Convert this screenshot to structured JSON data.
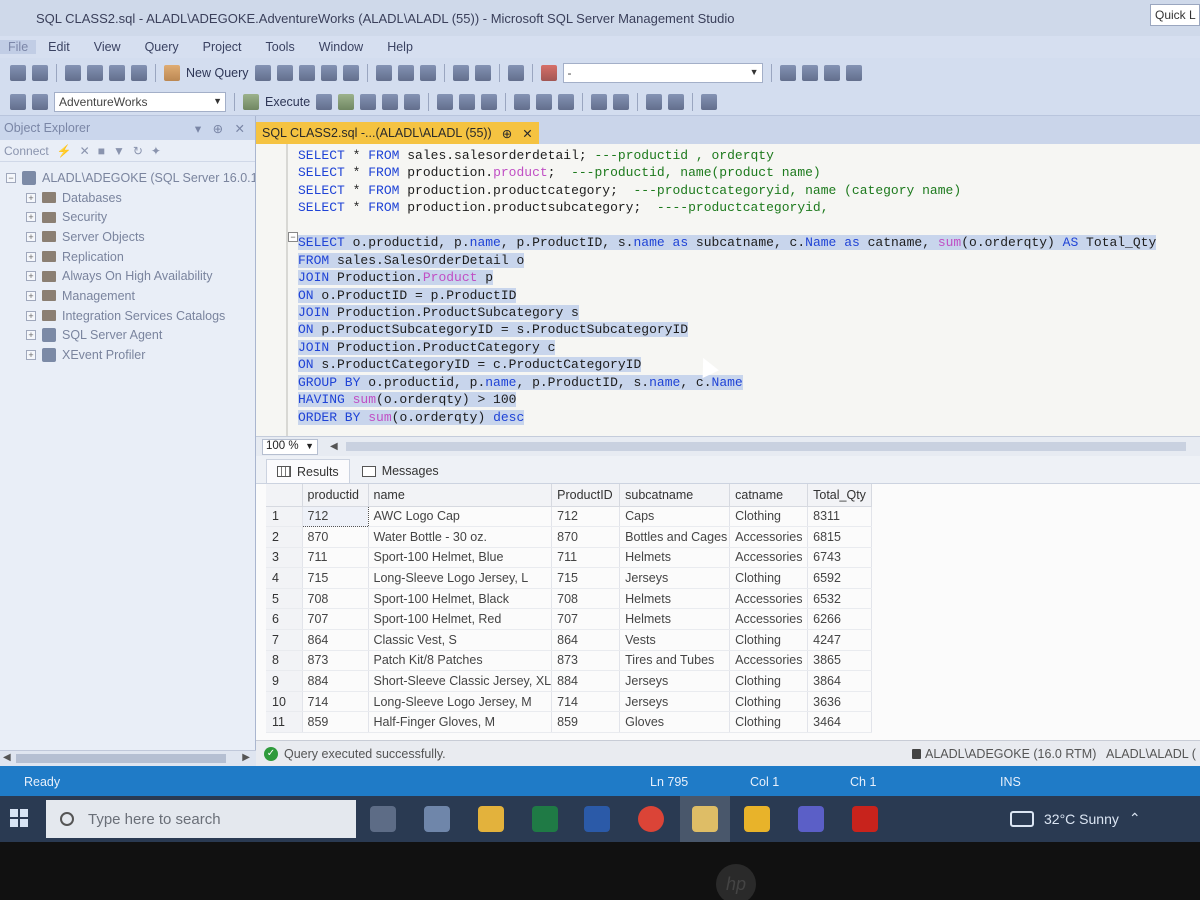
{
  "window": {
    "title": "SQL CLASS2.sql - ALADL\\ADEGOKE.AdventureWorks (ALADL\\ALADL (55)) - Microsoft SQL Server Management Studio",
    "quick_launch": "Quick L"
  },
  "menu": [
    "File",
    "Edit",
    "View",
    "Query",
    "Project",
    "Tools",
    "Window",
    "Help"
  ],
  "toolbar": {
    "new_query": "New Query",
    "execute": "Execute",
    "database": "AdventureWorks",
    "solution_combo": "-"
  },
  "object_explorer": {
    "title": "Object Explorer",
    "connect": "Connect",
    "server": "ALADL\\ADEGOKE (SQL Server 16.0.1",
    "nodes": [
      "Databases",
      "Security",
      "Server Objects",
      "Replication",
      "Always On High Availability",
      "Management",
      "Integration Services Catalogs",
      "SQL Server Agent",
      "XEvent Profiler"
    ]
  },
  "document_tab": {
    "label": "SQL CLASS2.sql -...(ALADL\\ALADL (55))",
    "pin": "⊕",
    "close": "✕"
  },
  "editor": {
    "lines": [
      {
        "selected": false,
        "tokens": [
          {
            "t": "kw",
            "v": "SELECT"
          },
          {
            "t": "txt",
            "v": " * "
          },
          {
            "t": "kw",
            "v": "FROM"
          },
          {
            "t": "txt",
            "v": " sales.salesorderdetail; "
          },
          {
            "t": "cm",
            "v": "---productid , orderqty"
          }
        ]
      },
      {
        "selected": false,
        "tokens": [
          {
            "t": "kw",
            "v": "SELECT"
          },
          {
            "t": "txt",
            "v": " * "
          },
          {
            "t": "kw",
            "v": "FROM"
          },
          {
            "t": "txt",
            "v": " production."
          },
          {
            "t": "fn",
            "v": "product"
          },
          {
            "t": "txt",
            "v": ";  "
          },
          {
            "t": "cm",
            "v": "---productid, name(product name)"
          }
        ]
      },
      {
        "selected": false,
        "tokens": [
          {
            "t": "kw",
            "v": "SELECT"
          },
          {
            "t": "txt",
            "v": " * "
          },
          {
            "t": "kw",
            "v": "FROM"
          },
          {
            "t": "txt",
            "v": " production.productcategory;  "
          },
          {
            "t": "cm",
            "v": "---productcategoryid, name (category name)"
          }
        ]
      },
      {
        "selected": false,
        "tokens": [
          {
            "t": "kw",
            "v": "SELECT"
          },
          {
            "t": "txt",
            "v": " * "
          },
          {
            "t": "kw",
            "v": "FROM"
          },
          {
            "t": "txt",
            "v": " production.productsubcategory;  "
          },
          {
            "t": "cm",
            "v": "----productcategoryid,"
          }
        ]
      },
      {
        "selected": false,
        "tokens": [
          {
            "t": "txt",
            "v": " "
          }
        ]
      },
      {
        "selected": true,
        "tokens": [
          {
            "t": "kw",
            "v": "SELECT"
          },
          {
            "t": "txt",
            "v": " o.productid, p."
          },
          {
            "t": "kw",
            "v": "name"
          },
          {
            "t": "txt",
            "v": ", p.ProductID, s."
          },
          {
            "t": "kw",
            "v": "name"
          },
          {
            "t": "txt",
            "v": " "
          },
          {
            "t": "kw",
            "v": "as"
          },
          {
            "t": "txt",
            "v": " subcatname, c."
          },
          {
            "t": "kw",
            "v": "Name"
          },
          {
            "t": "txt",
            "v": " "
          },
          {
            "t": "kw",
            "v": "as"
          },
          {
            "t": "txt",
            "v": " catname, "
          },
          {
            "t": "fn",
            "v": "sum"
          },
          {
            "t": "txt",
            "v": "(o.orderqty) "
          },
          {
            "t": "kw",
            "v": "AS"
          },
          {
            "t": "txt",
            "v": " Total_Qty"
          }
        ]
      },
      {
        "selected": true,
        "tokens": [
          {
            "t": "kw",
            "v": "FROM"
          },
          {
            "t": "txt",
            "v": " sales.SalesOrderDetail o"
          }
        ]
      },
      {
        "selected": true,
        "tokens": [
          {
            "t": "kw",
            "v": "JOIN"
          },
          {
            "t": "txt",
            "v": " Production."
          },
          {
            "t": "fn",
            "v": "Product"
          },
          {
            "t": "txt",
            "v": " p"
          }
        ]
      },
      {
        "selected": true,
        "tokens": [
          {
            "t": "kw",
            "v": "ON"
          },
          {
            "t": "txt",
            "v": " o.ProductID = p.ProductID"
          }
        ]
      },
      {
        "selected": true,
        "tokens": [
          {
            "t": "kw",
            "v": "JOIN"
          },
          {
            "t": "txt",
            "v": " Production.ProductSubcategory s"
          }
        ]
      },
      {
        "selected": true,
        "tokens": [
          {
            "t": "kw",
            "v": "ON"
          },
          {
            "t": "txt",
            "v": " p.ProductSubcategoryID = s.ProductSubcategoryID"
          }
        ]
      },
      {
        "selected": true,
        "tokens": [
          {
            "t": "kw",
            "v": "JOIN"
          },
          {
            "t": "txt",
            "v": " Production.ProductCategory c"
          }
        ]
      },
      {
        "selected": true,
        "tokens": [
          {
            "t": "kw",
            "v": "ON"
          },
          {
            "t": "txt",
            "v": " s.ProductCategoryID = c.ProductCategoryID"
          }
        ]
      },
      {
        "selected": true,
        "tokens": [
          {
            "t": "kw",
            "v": "GROUP BY"
          },
          {
            "t": "txt",
            "v": " o.productid, p."
          },
          {
            "t": "kw",
            "v": "name"
          },
          {
            "t": "txt",
            "v": ", p.ProductID, s."
          },
          {
            "t": "kw",
            "v": "name"
          },
          {
            "t": "txt",
            "v": ", c."
          },
          {
            "t": "kw",
            "v": "Name"
          }
        ]
      },
      {
        "selected": true,
        "tokens": [
          {
            "t": "kw",
            "v": "HAVING"
          },
          {
            "t": "txt",
            "v": " "
          },
          {
            "t": "fn",
            "v": "sum"
          },
          {
            "t": "txt",
            "v": "(o.orderqty) > 100"
          }
        ]
      },
      {
        "selected": true,
        "tokens": [
          {
            "t": "kw",
            "v": "ORDER BY"
          },
          {
            "t": "txt",
            "v": " "
          },
          {
            "t": "fn",
            "v": "sum"
          },
          {
            "t": "txt",
            "v": "(o.orderqty) "
          },
          {
            "t": "kw",
            "v": "desc"
          }
        ]
      }
    ]
  },
  "zoom": "100 %",
  "results_tabs": {
    "results": "Results",
    "messages": "Messages"
  },
  "results": {
    "columns": [
      "productid",
      "name",
      "ProductID",
      "subcatname",
      "catname",
      "Total_Qty"
    ],
    "rows": [
      [
        "1",
        "712",
        "AWC Logo Cap",
        "712",
        "Caps",
        "Clothing",
        "8311"
      ],
      [
        "2",
        "870",
        "Water Bottle - 30 oz.",
        "870",
        "Bottles and Cages",
        "Accessories",
        "6815"
      ],
      [
        "3",
        "711",
        "Sport-100 Helmet, Blue",
        "711",
        "Helmets",
        "Accessories",
        "6743"
      ],
      [
        "4",
        "715",
        "Long-Sleeve Logo Jersey, L",
        "715",
        "Jerseys",
        "Clothing",
        "6592"
      ],
      [
        "5",
        "708",
        "Sport-100 Helmet, Black",
        "708",
        "Helmets",
        "Accessories",
        "6532"
      ],
      [
        "6",
        "707",
        "Sport-100 Helmet, Red",
        "707",
        "Helmets",
        "Accessories",
        "6266"
      ],
      [
        "7",
        "864",
        "Classic Vest, S",
        "864",
        "Vests",
        "Clothing",
        "4247"
      ],
      [
        "8",
        "873",
        "Patch Kit/8 Patches",
        "873",
        "Tires and Tubes",
        "Accessories",
        "3865"
      ],
      [
        "9",
        "884",
        "Short-Sleeve Classic Jersey, XL",
        "884",
        "Jerseys",
        "Clothing",
        "3864"
      ],
      [
        "10",
        "714",
        "Long-Sleeve Logo Jersey, M",
        "714",
        "Jerseys",
        "Clothing",
        "3636"
      ],
      [
        "11",
        "859",
        "Half-Finger Gloves, M",
        "859",
        "Gloves",
        "Clothing",
        "3464"
      ]
    ]
  },
  "query_status": {
    "message": "Query executed successfully.",
    "connection": "ALADL\\ADEGOKE (16.0 RTM)",
    "user": "ALADL\\ALADL ("
  },
  "statusbar": {
    "state": "Ready",
    "line": "Ln 795",
    "col": "Col 1",
    "ch": "Ch 1",
    "mode": "INS"
  },
  "taskbar": {
    "search_placeholder": "Type here to search",
    "weather": "32°C  Sunny"
  },
  "colors": {
    "accent_tab": "#f5c341",
    "statusbar": "#1f7bc7",
    "keyword": "#1f43d6",
    "function": "#c04fc4",
    "comment": "#1d7a1d",
    "selection": "#c8d5ec"
  }
}
